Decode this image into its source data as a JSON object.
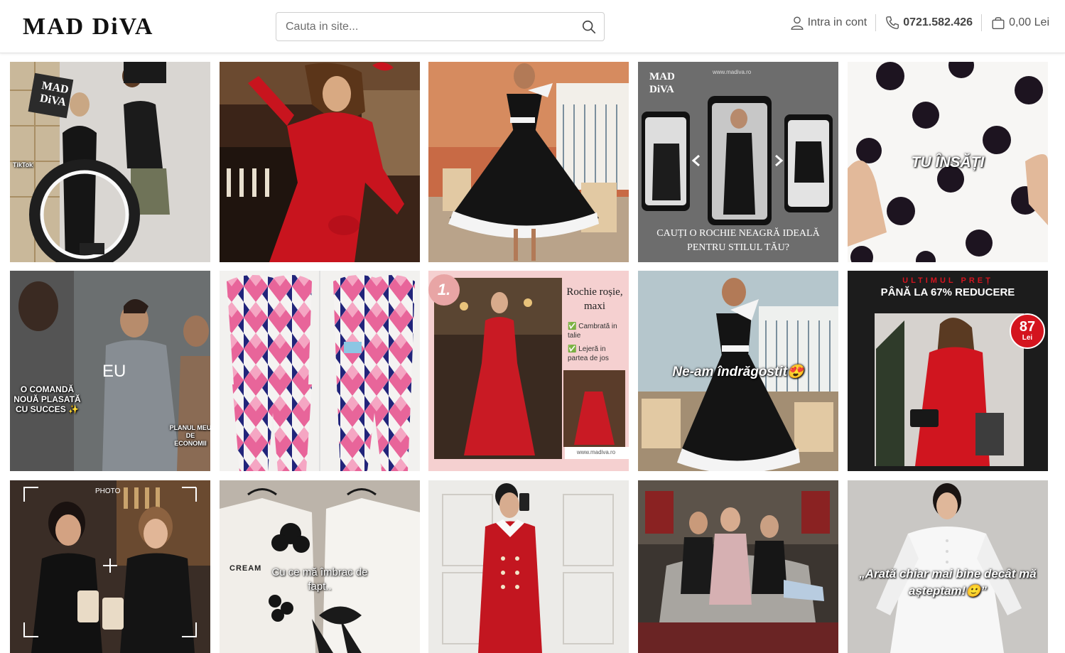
{
  "brand": {
    "logo": "MAD DiVA"
  },
  "search": {
    "placeholder": "Cauta in site..."
  },
  "nav": {
    "account": "Intra in cont",
    "phone": "0721.582.426",
    "cart": "0,00 Lei"
  },
  "tiles": [
    {
      "caption": "",
      "small": "TikTok",
      "logo_text": "MAD DiVA"
    },
    {
      "caption": ""
    },
    {
      "caption": ""
    },
    {
      "caption": "CAUȚI O ROCHIE NEAGRĂ IDEALĂ PENTRU STILUL TĂU?",
      "logo_text": "MAD DiVA",
      "site": "www.madiva.ro"
    },
    {
      "caption": "TU ÎNSĂȚI"
    },
    {
      "caption": "O COMANDĂ NOUĂ PLASATĂ CU SUCCES ✨",
      "label2": "EU",
      "label3": "PLANUL MEU DE ECONOMII"
    },
    {
      "caption": ""
    },
    {
      "caption": "Rochie roșie, maxi",
      "number": "1.",
      "bullet1": "Cambrată in talie",
      "bullet2": "Lejeră in partea de jos",
      "site": "www.madiva.ro"
    },
    {
      "caption": "Ne-am îndrăgostit😍"
    },
    {
      "caption": "PÂNĂ LA 67% REDUCERE",
      "top": "ULTIMUL PREȚ",
      "price": "87",
      "currency": "Lei"
    },
    {
      "caption": "",
      "label2": "PHOTO"
    },
    {
      "caption": "Cu ce mă îmbrac de fapt..",
      "label2": "CREAM"
    },
    {
      "caption": ""
    },
    {
      "caption": ""
    },
    {
      "caption": "„Arată chiar mai bine decât mă așteptam!🙂”"
    }
  ],
  "colors": {
    "accent_red": "#c8102e",
    "text_dark": "#111111",
    "border": "#cfcfcf"
  }
}
